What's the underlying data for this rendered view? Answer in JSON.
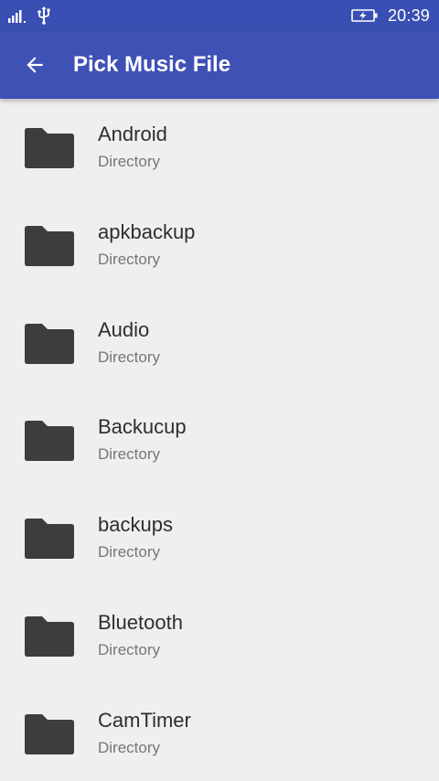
{
  "status_bar": {
    "signal_icon": "signal-bars-icon",
    "usb_icon": "usb-icon",
    "battery_icon": "battery-charging-icon",
    "time": "20:39"
  },
  "app_bar": {
    "back_icon": "arrow-left-icon",
    "title": "Pick Music File"
  },
  "list": {
    "items": [
      {
        "name": "Android",
        "type": "Directory",
        "icon": "folder-icon"
      },
      {
        "name": "apkbackup",
        "type": "Directory",
        "icon": "folder-icon"
      },
      {
        "name": "Audio",
        "type": "Directory",
        "icon": "folder-icon"
      },
      {
        "name": "Backucup",
        "type": "Directory",
        "icon": "folder-icon"
      },
      {
        "name": "backups",
        "type": "Directory",
        "icon": "folder-icon"
      },
      {
        "name": "Bluetooth",
        "type": "Directory",
        "icon": "folder-icon"
      },
      {
        "name": "CamTimer",
        "type": "Directory",
        "icon": "folder-icon"
      }
    ]
  },
  "colors": {
    "status_bar": "#3a4fb3",
    "app_bar": "#3f51b5",
    "background": "#efefef",
    "folder": "#3d3d3d",
    "title_text": "#2e2e2e",
    "subtitle_text": "#767676"
  }
}
